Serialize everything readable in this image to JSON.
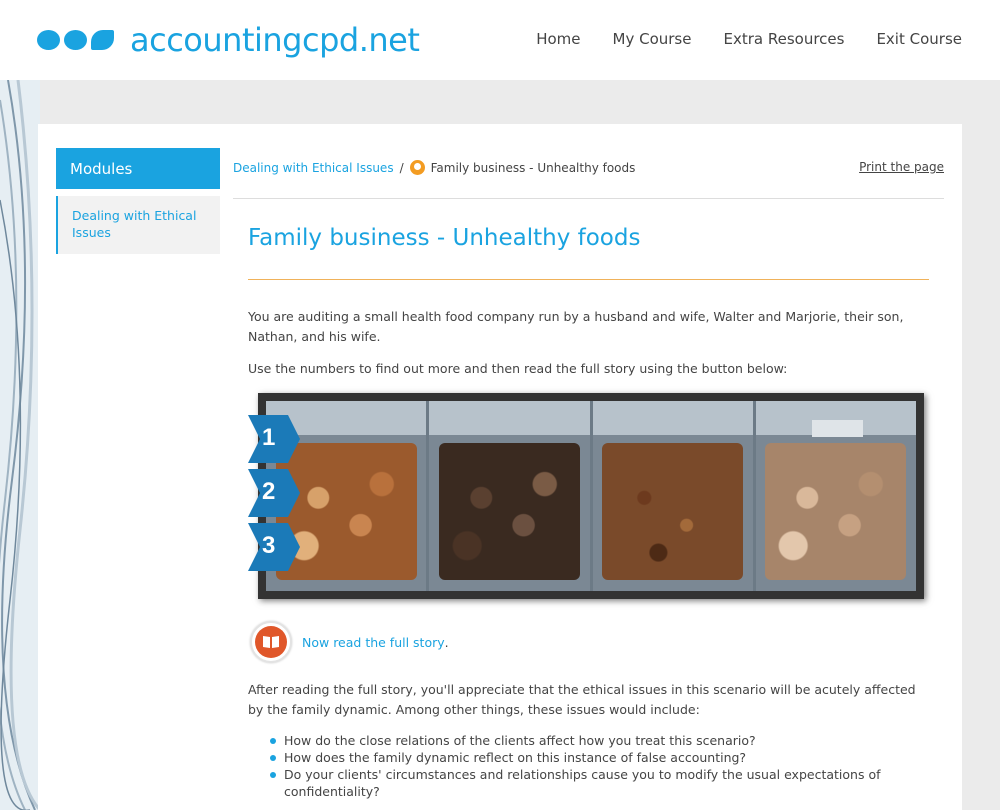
{
  "header": {
    "logo_text": "accountingcpd.net",
    "nav": [
      "Home",
      "My Course",
      "Extra Resources",
      "Exit Course"
    ]
  },
  "sidebar": {
    "heading": "Modules",
    "items": [
      {
        "label": "Dealing with Ethical Issues"
      }
    ]
  },
  "breadcrumb": {
    "parent": "Dealing with Ethical Issues",
    "separator": "/",
    "current": "Family business - Unhealthy foods"
  },
  "print_label": "Print the page",
  "page_title": "Family business - Unhealthy foods",
  "intro": "You are auditing a small health food company run by a husband and wife, Walter and Marjorie, their son, Nathan, and his wife.",
  "instruction": "Use the numbers to find out more and then read the full story using the button below:",
  "hotspots": [
    "1",
    "2",
    "3"
  ],
  "story_link": "Now read the full story",
  "story_period": ".",
  "after_reading": "After reading the full story, you'll appreciate that the ethical issues in this scenario will be acutely affected by the family dynamic. Among other things, these issues would include:",
  "issues": [
    "How do the close relations of the clients affect how you treat this scenario?",
    "How does the family dynamic reflect on this instance of false accounting?",
    "Do your clients' circumstances and relationships cause you to modify the usual expectations of confidentiality?"
  ],
  "colors": {
    "brand": "#1aa3e0",
    "accent_rule": "#f0b25a",
    "hotspot": "#1b7ab8",
    "book_icon": "#e0572a"
  }
}
